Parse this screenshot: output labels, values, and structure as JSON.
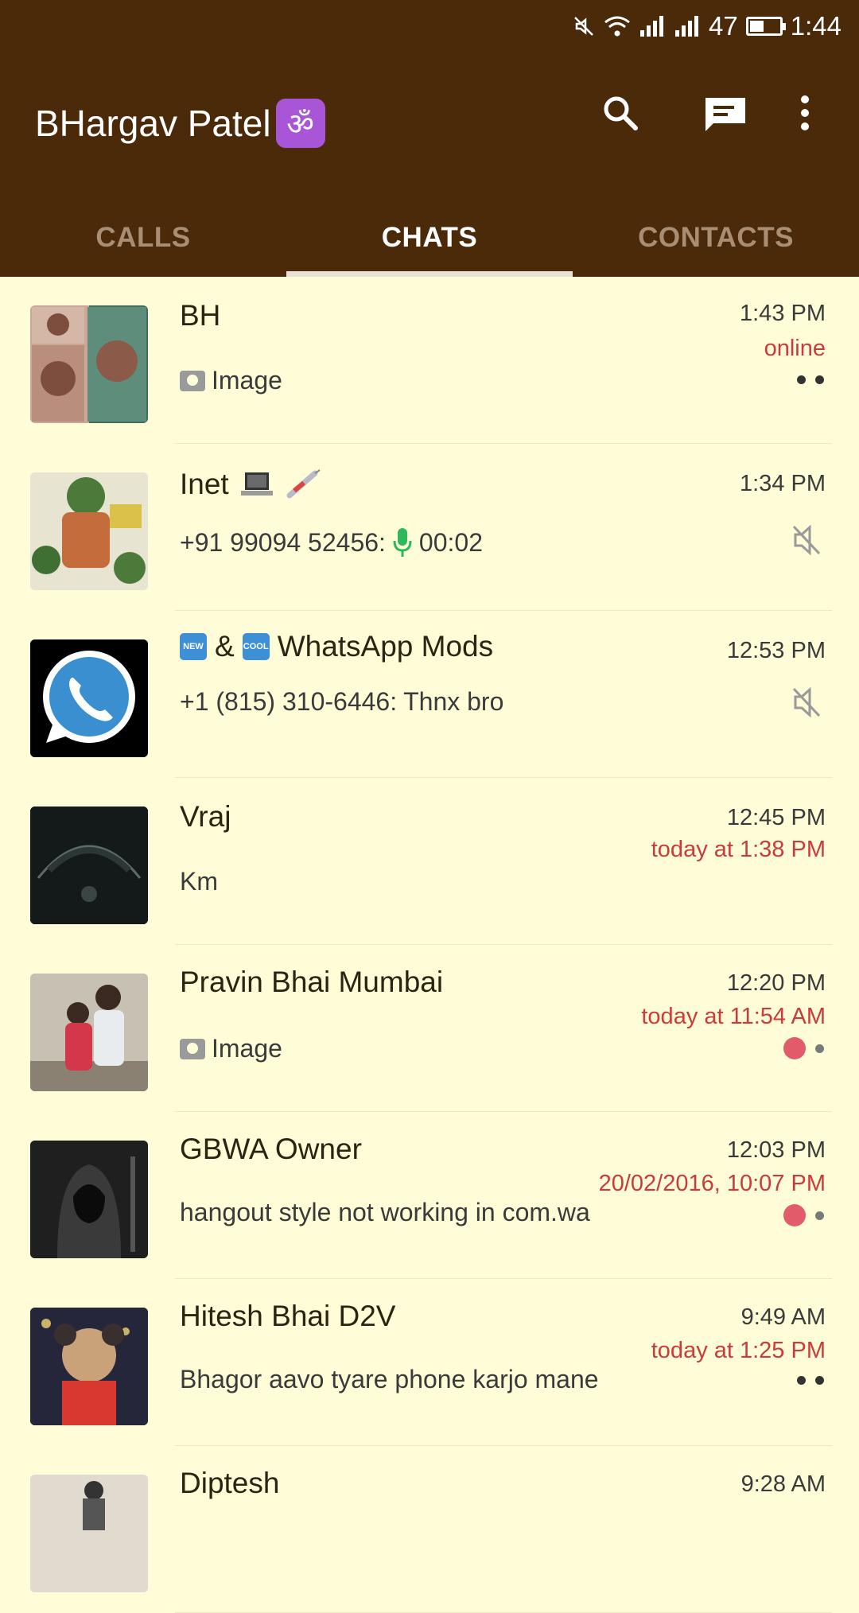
{
  "status_bar": {
    "battery": "47",
    "time": "1:44"
  },
  "app": {
    "title": "BHargav Patel",
    "title_emoji": "ॐ"
  },
  "tabs": [
    {
      "label": "CALLS",
      "active": false
    },
    {
      "label": "CHATS",
      "active": true
    },
    {
      "label": "CONTACTS",
      "active": false
    }
  ],
  "chats": [
    {
      "name": "BH",
      "preview": "Image",
      "time": "1:43 PM",
      "seen": "online"
    },
    {
      "name": "Inet",
      "sender": "+91 99094 52456:",
      "preview": "00:02",
      "time": "1:34 PM"
    },
    {
      "name_joiner": "&",
      "name": "WhatsApp Mods",
      "sender": "+1 (815) 310-6446:",
      "preview": "Thnx bro",
      "time": "12:53 PM"
    },
    {
      "name": "Vraj",
      "preview": "Km",
      "time": "12:45 PM",
      "seen": "today at 1:38 PM"
    },
    {
      "name": "Pravin Bhai Mumbai",
      "preview": "Image",
      "time": "12:20 PM",
      "seen": "today at 11:54 AM"
    },
    {
      "name": "GBWA Owner",
      "preview": "hangout style not working in com.wa",
      "time": "12:03 PM",
      "seen": "20/02/2016, 10:07 PM"
    },
    {
      "name": "Hitesh Bhai D2V",
      "preview": "Bhagor aavo tyare phone karjo mane",
      "time": "9:49 AM",
      "seen": "today at 1:25 PM"
    },
    {
      "name": "Diptesh",
      "time": "9:28 AM"
    }
  ],
  "colors": {
    "header": "#4b2a0a",
    "background": "#fefdd8",
    "seen": "#cc3b3b",
    "mic": "#2eb85c",
    "unread": "#e25b6a"
  }
}
